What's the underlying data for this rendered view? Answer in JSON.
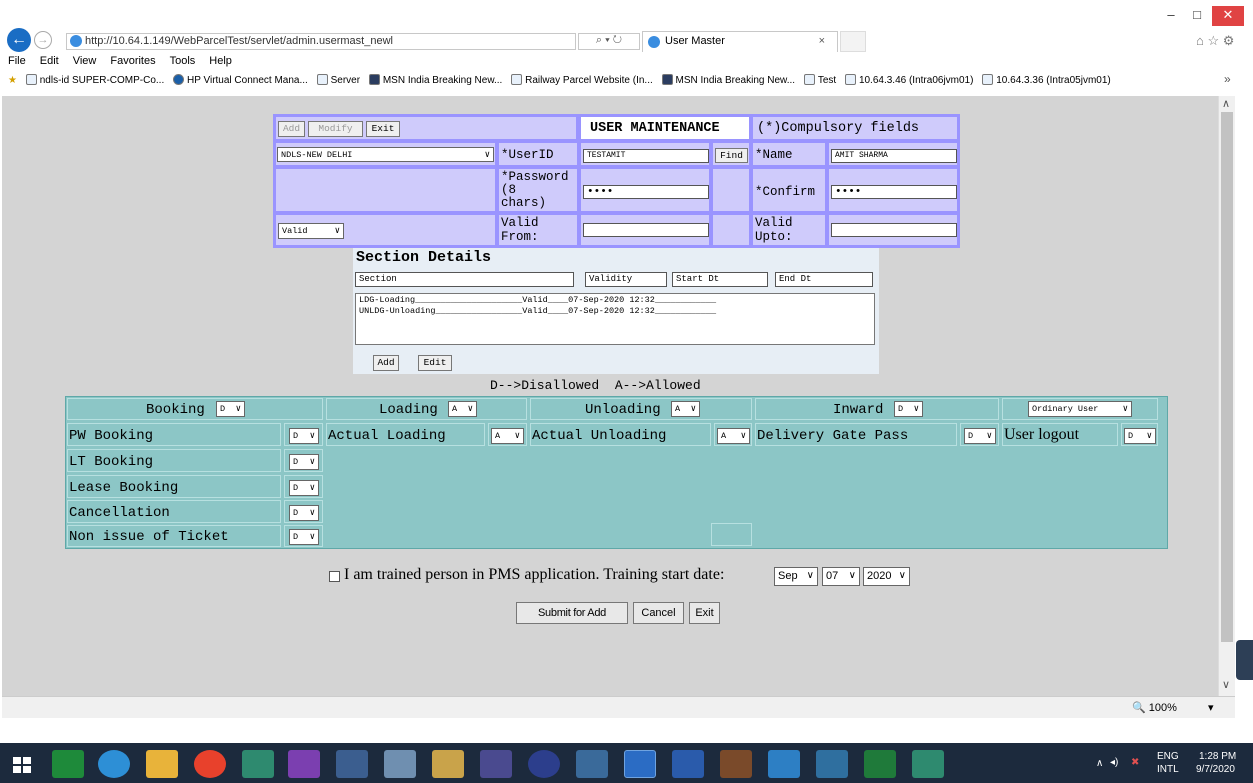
{
  "browser": {
    "url": "http://10.64.1.149/WebParcelTest/servlet/admin.usermast_newl",
    "search_icon_text": "⌕ ▾ ↻",
    "tab_title": "User Master",
    "tab_close": "×",
    "menu": [
      "File",
      "Edit",
      "View",
      "Favorites",
      "Tools",
      "Help"
    ],
    "favorites": [
      "ndls-id SUPER-COMP-Co...",
      "HP Virtual Connect Mana...",
      "Server",
      "MSN India  Breaking New...",
      "Railway Parcel Website (In...",
      "MSN India  Breaking New...",
      "Test",
      "10.64.3.46 (Intra06jvm01)",
      "10.64.3.36 (Intra05jvm01)"
    ],
    "zoom": "🔍 100%",
    "zoom_arrow": "▾",
    "more_chevron": "»",
    "win_min": "–",
    "win_max": "□",
    "win_close": "✕",
    "right_icons": "⌂ ☆ ⚙"
  },
  "form": {
    "add_label": "Add",
    "modify_label": "Modify",
    "exit_label": "Exit",
    "title": "USER MAINTENANCE",
    "compulsory_note": "(*)Compulsory fields",
    "station_select": "NDLS-NEW DELHI",
    "userid_label": "*UserID",
    "userid_value": "TESTAMIT",
    "find_label": "Find",
    "name_label": "*Name",
    "name_value": "AMIT SHARMA",
    "password_label_1": "*Password",
    "password_label_2": "(8",
    "password_label_3": "chars)",
    "password_value": "••••",
    "confirm_label": "*Confirm",
    "confirm_value": "••••",
    "validity_select": "Valid",
    "valid_from_1": "Valid",
    "valid_from_2": "From:",
    "valid_upto_1": "Valid",
    "valid_upto_2": "Upto:"
  },
  "section": {
    "heading": "Section Details",
    "col_section": "Section",
    "col_validity": "Validity",
    "col_start": "Start Dt",
    "col_end": "End Dt",
    "rows": [
      "LDG-Loading_____________________Valid____07-Sep-2020 12:32____________",
      "UNLDG-Unloading_________________Valid____07-Sep-2020 12:32____________"
    ],
    "add_label": "Add",
    "edit_label": "Edit"
  },
  "legend": "D-->Disallowed  A-->Allowed",
  "perms": {
    "headers": [
      {
        "label": "Booking",
        "value": "D"
      },
      {
        "label": "Loading",
        "value": "A"
      },
      {
        "label": "Unloading",
        "value": "A"
      },
      {
        "label": "Inward",
        "value": "D"
      }
    ],
    "user_type": "Ordinary User",
    "booking_rows": [
      {
        "label": "PW Booking",
        "value": "D"
      },
      {
        "label": "LT Booking",
        "value": "D"
      },
      {
        "label": "Lease Booking",
        "value": "D"
      },
      {
        "label": "Cancellation",
        "value": "D"
      },
      {
        "label": "Non issue of Ticket",
        "value": "D"
      }
    ],
    "actual_loading": {
      "label": "Actual Loading",
      "value": "A"
    },
    "actual_unloading": {
      "label": "Actual Unloading",
      "value": "A"
    },
    "delivery_gate_pass": {
      "label": "Delivery Gate Pass",
      "value": "D"
    },
    "user_logout": {
      "label": "User logout",
      "value": "D"
    }
  },
  "training": {
    "text": "I am trained person in PMS application. Training start date:",
    "month": "Sep",
    "day": "07",
    "year": "2020"
  },
  "actions": {
    "submit_label": "Submit for Add",
    "cancel_label": "Cancel",
    "exit_label": "Exit"
  },
  "taskbar": {
    "lang_1": "ENG",
    "lang_2": "INTL",
    "time": "1:28 PM",
    "date": "9/7/2020"
  },
  "colors": {
    "form_bg": "#cfcbfb",
    "perm_bg": "#8cc6c6",
    "taskbar": "#1c2a3d"
  }
}
